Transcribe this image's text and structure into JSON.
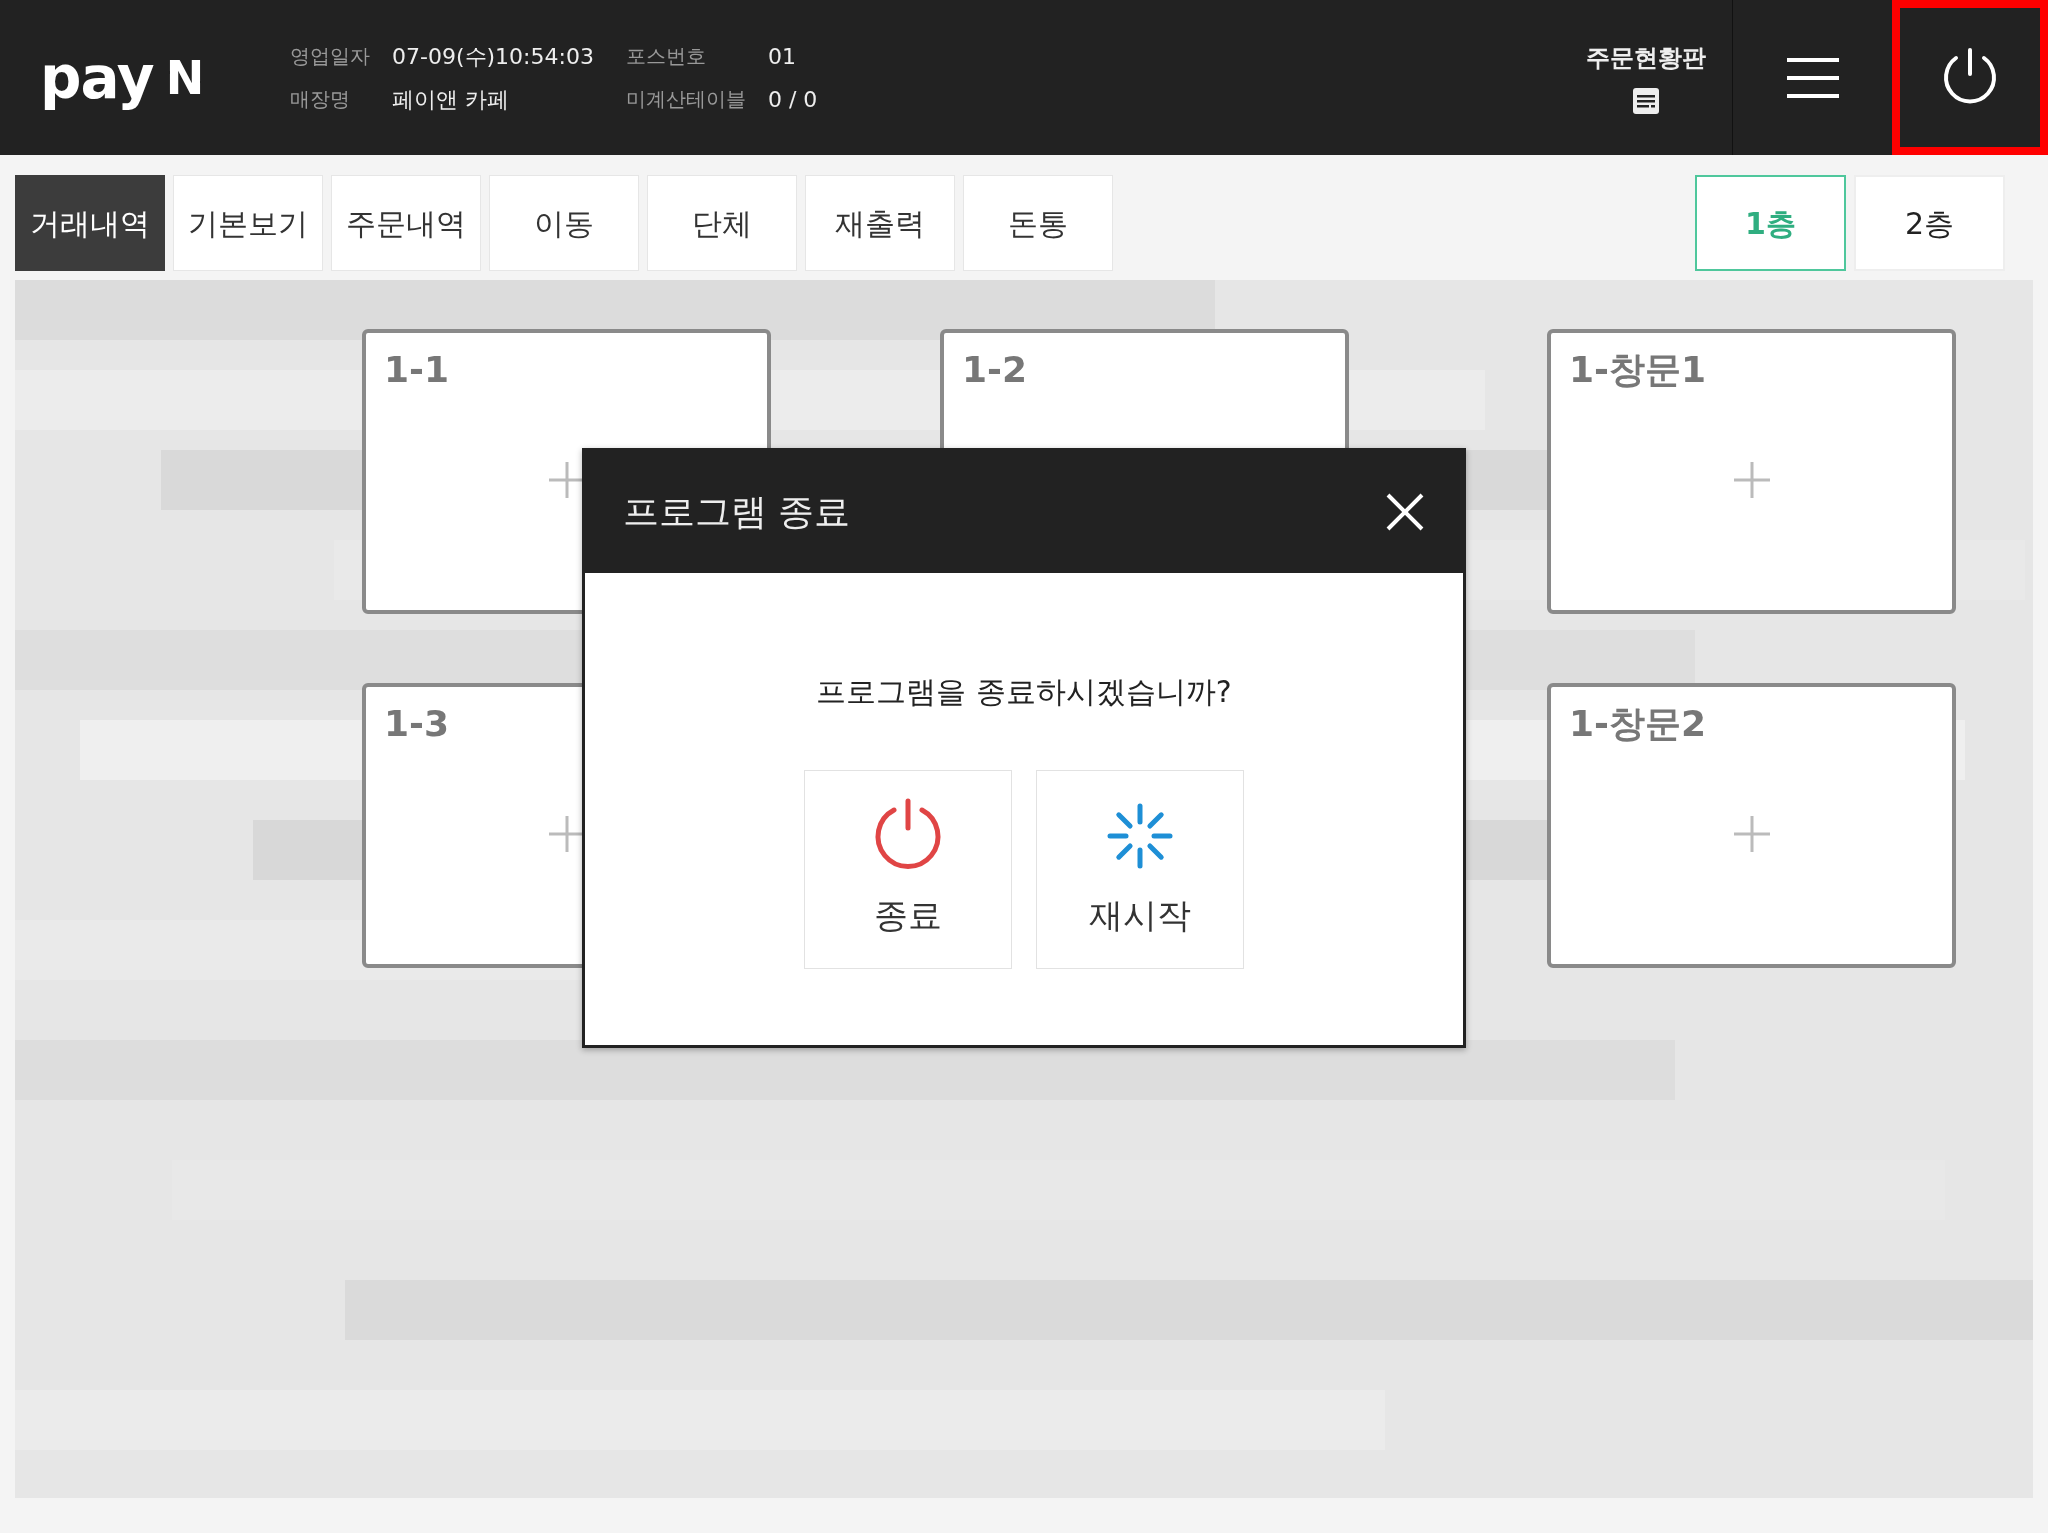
{
  "header": {
    "logo": {
      "text": "pay",
      "mark": "N"
    },
    "info": [
      {
        "label": "영업일자",
        "value": "07-09(수)10:54:03"
      },
      {
        "label": "포스번호",
        "value": "01"
      },
      {
        "label": "매장명",
        "value": "페이앤 카페"
      },
      {
        "label": "미계산테이블",
        "value": "0 / 0"
      }
    ],
    "order_board": "주문현황판",
    "power_highlighted": true
  },
  "tabs": [
    {
      "label": "거래내역",
      "selected": true
    },
    {
      "label": "기본보기",
      "selected": false
    },
    {
      "label": "주문내역",
      "selected": false
    },
    {
      "label": "이동",
      "selected": false
    },
    {
      "label": "단체",
      "selected": false
    },
    {
      "label": "재출력",
      "selected": false
    },
    {
      "label": "돈통",
      "selected": false
    }
  ],
  "floors": [
    {
      "label": "1층",
      "selected": true
    },
    {
      "label": "2층",
      "selected": false
    }
  ],
  "tables": [
    {
      "label": "1-1"
    },
    {
      "label": "1-2"
    },
    {
      "label": "1-창문1"
    },
    {
      "label": "1-3"
    },
    {
      "label": "1-창문2"
    }
  ],
  "dialog": {
    "title": "프로그램 종료",
    "message": "프로그램을 종료하시겠습니까?",
    "buttons": [
      {
        "kind": "exit",
        "label": "종료"
      },
      {
        "kind": "restart",
        "label": "재시작"
      }
    ]
  }
}
